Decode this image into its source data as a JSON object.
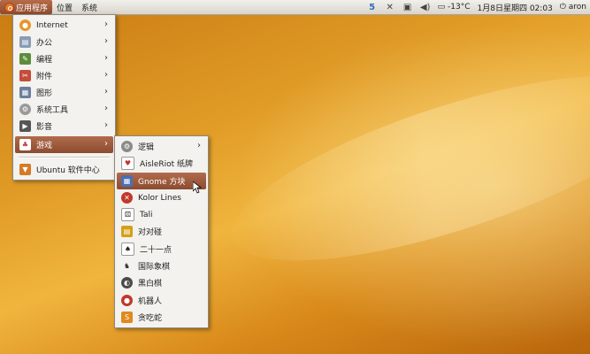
{
  "panel": {
    "menus": [
      "应用程序",
      "位置",
      "系统"
    ],
    "clock": "1月8日星期四 02:03",
    "temperature": "-13°C",
    "user": "aron"
  },
  "apps_menu": {
    "items": [
      {
        "label": "Internet",
        "icon": "globe-icon",
        "color": "#e7962a"
      },
      {
        "label": "办公",
        "icon": "office-icon",
        "color": "#8a9bb5"
      },
      {
        "label": "编程",
        "icon": "programming-icon",
        "color": "#5d8c3c"
      },
      {
        "label": "附件",
        "icon": "accessories-icon",
        "color": "#c44d3a"
      },
      {
        "label": "图形",
        "icon": "graphics-icon",
        "color": "#6c7f9d"
      },
      {
        "label": "系统工具",
        "icon": "system-tools-icon",
        "color": "#9a9a9a"
      },
      {
        "label": "影音",
        "icon": "multimedia-icon",
        "color": "#555555"
      },
      {
        "label": "游戏",
        "icon": "games-icon",
        "color": "#c83b3b"
      },
      {
        "label": "Ubuntu 软件中心",
        "icon": "software-center-icon",
        "color": "#d67a26"
      }
    ],
    "highlight_color": "#a05a3c"
  },
  "games_menu": {
    "items": [
      {
        "label": "逻辑",
        "icon": "logic-icon",
        "color": "#8b8b8b"
      },
      {
        "label": "AisleRiot 纸牌",
        "icon": "cards-icon",
        "color": "#c23434"
      },
      {
        "label": "Gnome 方块",
        "icon": "tetris-icon",
        "color": "#4a6fb5"
      },
      {
        "label": "Kolor Lines",
        "icon": "kolor-lines-icon",
        "color": "#c0392b"
      },
      {
        "label": "Tali",
        "icon": "dice-icon",
        "color": "#777777"
      },
      {
        "label": "对对碰",
        "icon": "same-icon",
        "color": "#d4a017"
      },
      {
        "label": "二十一点",
        "icon": "blackjack-icon",
        "color": "#555555"
      },
      {
        "label": "国际象棋",
        "icon": "chess-icon",
        "color": "#333333"
      },
      {
        "label": "黑白棋",
        "icon": "reversi-icon",
        "color": "#4a4a4a"
      },
      {
        "label": "机器人",
        "icon": "robots-icon",
        "color": "#c0392b"
      },
      {
        "label": "贪吃蛇",
        "icon": "snake-icon",
        "color": "#e08a1e"
      }
    ]
  }
}
